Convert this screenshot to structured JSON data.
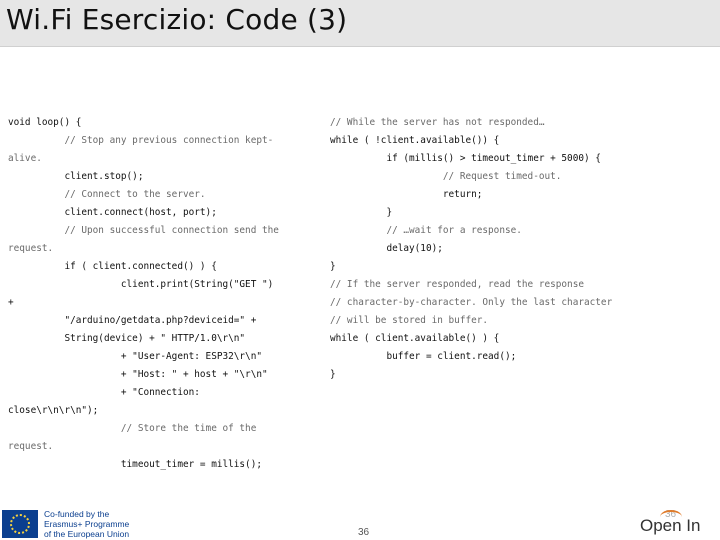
{
  "slide": {
    "title": "Wi.Fi Esercizio: Code (3)",
    "page_number": "36",
    "page_number_faint": "36"
  },
  "left_code": [
    "void loop() {",
    "          // Stop any previous connection kept-",
    "alive.",
    "          client.stop();",
    "          // Connect to the server.",
    "          client.connect(host, port);",
    "          // Upon successful connection send the",
    "request.",
    "          if ( client.connected() ) {",
    "                    client.print(String(\"GET \")",
    "+",
    "          \"/arduino/getdata.php?deviceid=\" +",
    "          String(device) + \" HTTP/1.0\\r\\n\"",
    "                    + \"User-Agent: ESP32\\r\\n\"",
    "                    + \"Host: \" + host + \"\\r\\n\"",
    "                    + \"Connection:",
    "close\\r\\n\\r\\n\");",
    "                    // Store the time of the",
    "request.",
    "                    timeout_timer = millis();"
  ],
  "right_code": [
    "// While the server has not responded…",
    "while ( !client.available()) {",
    "          if (millis() > timeout_timer + 5000) {",
    "                    // Request timed-out.",
    "                    return;",
    "          }",
    "          // …wait for a response.",
    "          delay(10);",
    "}",
    "// If the server responded, read the response",
    "// character-by-character. Only the last character",
    "// will be stored in buffer.",
    "while ( client.available() ) {",
    "          buffer = client.read();",
    "}"
  ],
  "footer": {
    "eu_text": "Co-funded by the\nErasmus+ Programme\nof the European Union",
    "logo_text": "Open In"
  },
  "colors": {
    "title_bar": "#e6e6e6",
    "eu_blue": "#0b3f8f",
    "logo_accent": "#e07b2a"
  }
}
